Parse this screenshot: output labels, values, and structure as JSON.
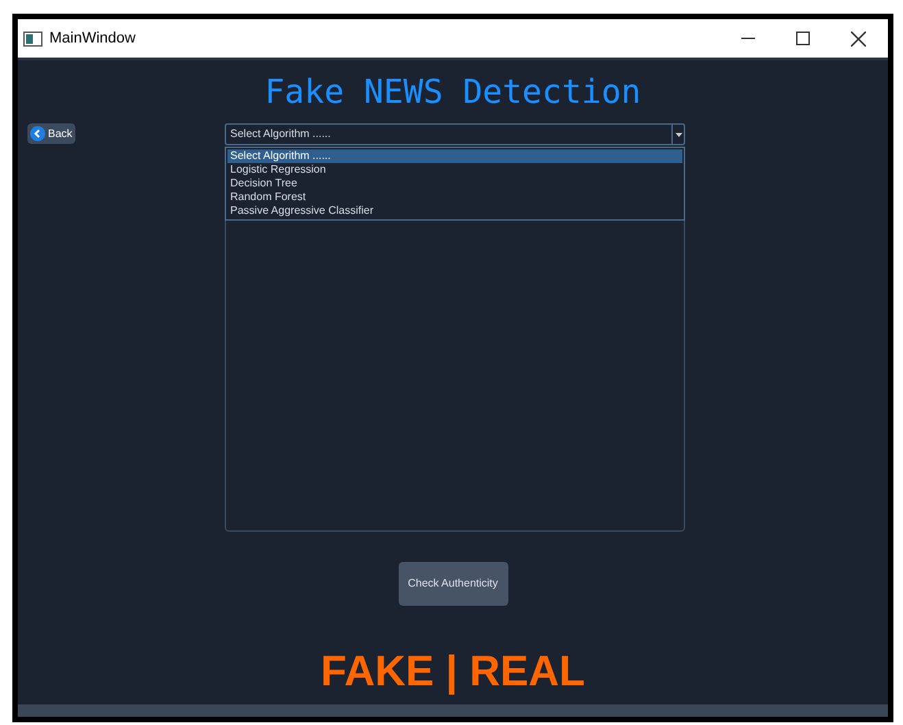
{
  "window": {
    "title": "MainWindow"
  },
  "title": "Fake NEWS Detection",
  "back_button": {
    "label": "Back"
  },
  "algorithm_select": {
    "value": "Select Algorithm ......",
    "expanded": true,
    "options": [
      {
        "label": "Select Algorithm ......",
        "selected": true
      },
      {
        "label": "Logistic Regression",
        "selected": false
      },
      {
        "label": "Decision Tree",
        "selected": false
      },
      {
        "label": "Random Forest",
        "selected": false
      },
      {
        "label": "Passive Aggressive Classifier",
        "selected": false
      }
    ]
  },
  "check_button": {
    "label": "Check Authenticity"
  },
  "result": "FAKE | REAL"
}
